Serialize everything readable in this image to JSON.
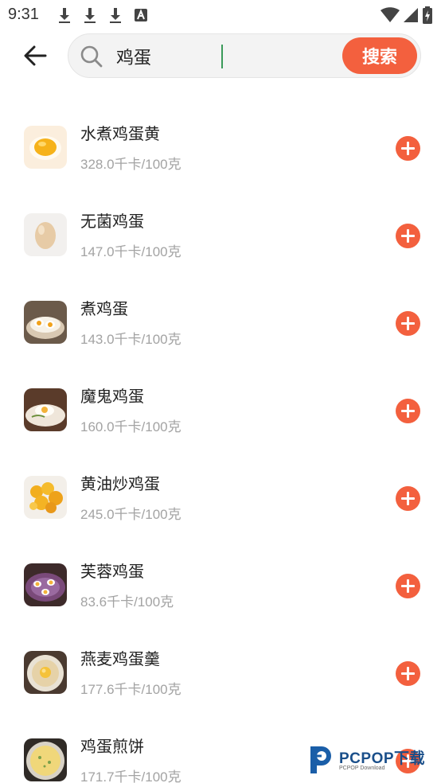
{
  "status_bar": {
    "time": "9:31"
  },
  "search": {
    "query": "鸡蛋",
    "button_label": "搜索"
  },
  "colors": {
    "accent": "#f3603e",
    "text_primary": "#222222",
    "text_secondary": "#a3a3a3"
  },
  "foods": [
    {
      "name": "水煮鸡蛋黄",
      "calories": "328.0千卡/100克",
      "icon": "egg-yolk-thumb"
    },
    {
      "name": "无菌鸡蛋",
      "calories": "147.0千卡/100克",
      "icon": "whole-egg-thumb"
    },
    {
      "name": "煮鸡蛋",
      "calories": "143.0千卡/100克",
      "icon": "boiled-egg-thumb"
    },
    {
      "name": "魔鬼鸡蛋",
      "calories": "160.0千卡/100克",
      "icon": "deviled-egg-thumb"
    },
    {
      "name": "黄油炒鸡蛋",
      "calories": "245.0千卡/100克",
      "icon": "butter-egg-thumb"
    },
    {
      "name": "芙蓉鸡蛋",
      "calories": "83.6千卡/100克",
      "icon": "egg-foo-young-thumb"
    },
    {
      "name": "燕麦鸡蛋羹",
      "calories": "177.6千卡/100克",
      "icon": "oat-egg-custard-thumb"
    },
    {
      "name": "鸡蛋煎饼",
      "calories": "171.7千卡/100克",
      "icon": "egg-pancake-thumb"
    }
  ],
  "watermark": {
    "brand": "PCPOP下载",
    "sub": "PCPOP Download"
  }
}
